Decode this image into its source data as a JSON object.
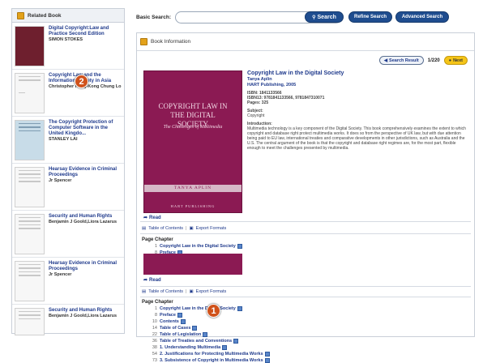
{
  "sidebar": {
    "title": "Related Book",
    "books": [
      {
        "title": "Digital Copyright:Law and Practice Second Edition",
        "author": "SIMON STOKES"
      },
      {
        "title": "Copyright Law and the Information Society in Asia",
        "author": "Christopher Heng-Kong Chung Lo"
      },
      {
        "title": "The Copyright Protection of Computer Software in the United Kingdo...",
        "author": "STANLEY LAI"
      },
      {
        "title": "Hearsay Evidence in Criminal Proceedings",
        "author": "Jr Spencer"
      },
      {
        "title": "Security and Human Rights",
        "author": "Benjamin J Goold,Liora Lazarus"
      },
      {
        "title": "Hearsay Evidence in Criminal Proceedings",
        "author": "Jr Spencer"
      },
      {
        "title": "Security and Human Rights",
        "author": "Benjamin J Goold,Liora Lazarus"
      }
    ]
  },
  "search": {
    "label": "Basic Search:",
    "button": "Search",
    "refine": "Refine Search",
    "advanced": "Advanced Search"
  },
  "main": {
    "header": "Book Information",
    "result_label": "Search Result",
    "result_count": "1/220",
    "next_label": "Next"
  },
  "book": {
    "title": "Copyright Law in the Digital Society",
    "author": "Tanya Aplin",
    "publisher": "HART Publishing, 2005",
    "isbn": "ISBN: 1841133566",
    "isbn13": "ISBN13: 9781841133566, 9781847310071",
    "pages": "Pages: 325",
    "subject_label": "Subject:",
    "subject": "Copyright",
    "intro_label": "Introduction:",
    "intro": "Multimedia technology is a key component of the Digital Society. This book comprehensively examines the extent to which copyright and database right protect multimedia works. It does so from the perspective of UK law, but with due attention being paid to EU law, international treaties and comparative developments in other jurisdictions, such as Australia and the U.S. The central argument of the book is that the copyright and database right regimes are, for the most part, flexible enough to meet the challenges presented by multimedia.",
    "cover_title": "COPYRIGHT LAW IN THE DIGITAL SOCIETY",
    "cover_sub": "The Challenges of Multimedia",
    "cover_author": "TANYA APLIN",
    "cover_pub": "HART PUBLISHING"
  },
  "read_label": "Read",
  "toc_label": "Table of Contents",
  "export_label": "Export Formats",
  "page_chapter": "Page Chapter",
  "chapters1": [
    {
      "n": "1",
      "t": "Copyright Law in the Digital Society"
    },
    {
      "n": "8",
      "t": "Preface"
    }
  ],
  "chapters2": [
    {
      "n": "1",
      "t": "Copyright Law in the Digital Society"
    },
    {
      "n": "8",
      "t": "Preface"
    },
    {
      "n": "10",
      "t": "Contents"
    },
    {
      "n": "14",
      "t": "Table of Cases"
    },
    {
      "n": "22",
      "t": "Table of Legislation"
    },
    {
      "n": "36",
      "t": "Table of Treaties and Conventions"
    },
    {
      "n": "38",
      "t": "1. Understanding Multimedia"
    },
    {
      "n": "54",
      "t": "2. Justifications for Protecting Multimedia Works"
    },
    {
      "n": "73",
      "t": "3. Subsistence of Copyright in Multimedia Works"
    }
  ],
  "markers": [
    "1",
    "2"
  ],
  "colors": {
    "accent": "#1f4d8f",
    "link": "#1f3a8c",
    "marker": "#d0521b",
    "cover": "#8b1a53"
  }
}
